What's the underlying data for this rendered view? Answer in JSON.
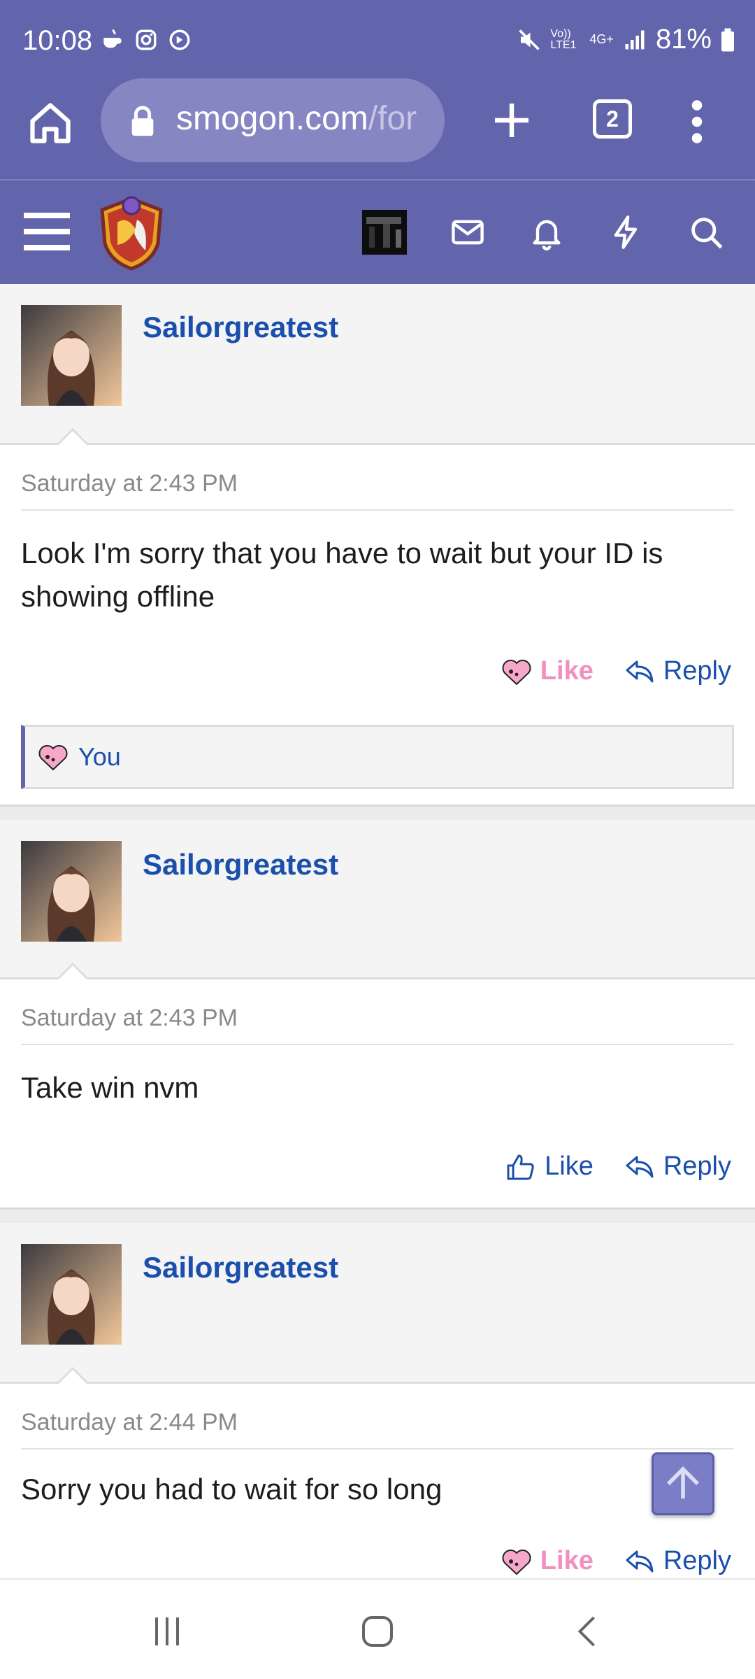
{
  "status_bar": {
    "time": "10:08",
    "battery": "81%",
    "network": "4G+",
    "volte": "Vo)) LTE1",
    "icons_left": [
      "cup-icon",
      "instagram-icon",
      "sync-icon"
    ],
    "icons_right": [
      "mute-icon",
      "signal-icon",
      "battery-icon"
    ]
  },
  "browser": {
    "url_main": "smogon.com",
    "url_dim": "/for",
    "tab_count": "2"
  },
  "header": {
    "icons": [
      "menu-icon",
      "logo",
      "avatar",
      "mail-icon",
      "bell-icon",
      "bolt-icon",
      "search-icon"
    ]
  },
  "posts": [
    {
      "username": "Sailorgreatest",
      "date": "Saturday at 2:43 PM",
      "text": "Look I'm sorry that you have to wait but your ID is showing offline",
      "like_label": "Like",
      "reply_label": "Reply",
      "liked": true,
      "reaction_user": "You"
    },
    {
      "username": "Sailorgreatest",
      "date": "Saturday at 2:43 PM",
      "text": "Take win nvm",
      "like_label": "Like",
      "reply_label": "Reply",
      "liked": false
    },
    {
      "username": "Sailorgreatest",
      "date": "Saturday at 2:44 PM",
      "text": "Sorry you had to wait for so long",
      "like_label": "Like",
      "reply_label": "Reply",
      "liked": true
    }
  ],
  "colors": {
    "brand": "#6365ac",
    "link": "#1a4fad",
    "like_active": "#f28fbf"
  }
}
